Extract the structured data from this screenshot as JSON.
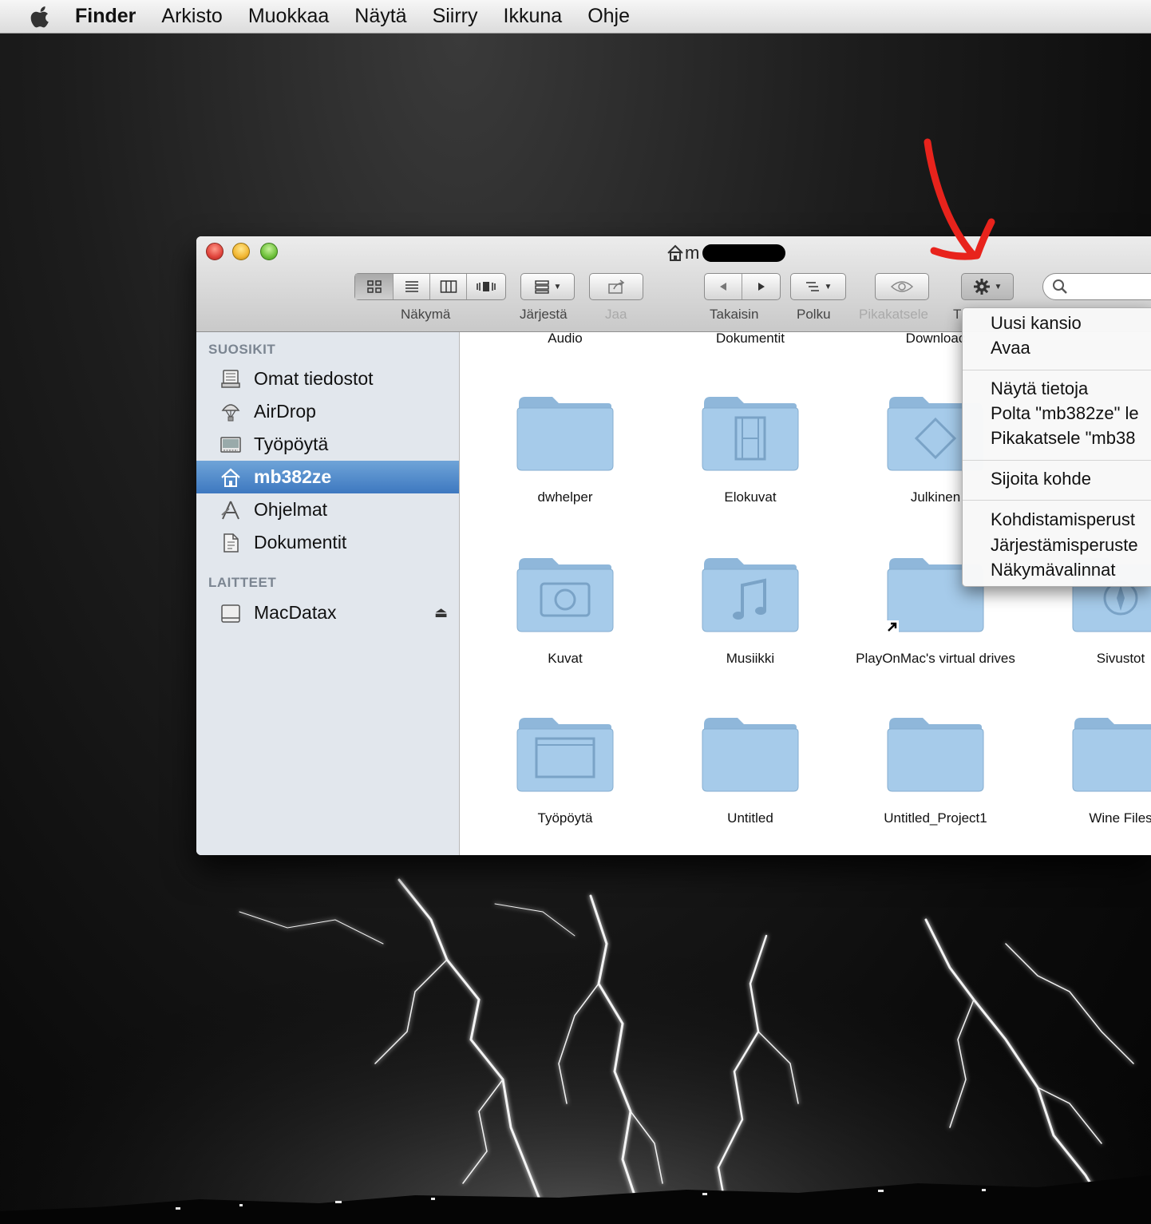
{
  "menubar": {
    "app": "Finder",
    "items": [
      "Arkisto",
      "Muokkaa",
      "Näytä",
      "Siirry",
      "Ikkuna",
      "Ohje"
    ]
  },
  "window": {
    "title_visible": "m",
    "toolbar": {
      "view_label": "Näkymä",
      "arrange_label": "Järjestä",
      "share_label": "Jaa",
      "back_label": "Takaisin",
      "path_label": "Polku",
      "quicklook_label": "Pikakatsele",
      "action_label_partial": "T"
    },
    "sidebar": {
      "favorites_header": "SUOSIKIT",
      "favorites": [
        {
          "label": "Omat tiedostot",
          "icon": "all-files-icon"
        },
        {
          "label": "AirDrop",
          "icon": "airdrop-icon"
        },
        {
          "label": "Työpöytä",
          "icon": "desktop-icon"
        },
        {
          "label": "mb382ze",
          "icon": "home-icon",
          "selected": true
        },
        {
          "label": "Ohjelmat",
          "icon": "applications-icon"
        },
        {
          "label": "Dokumentit",
          "icon": "documents-icon"
        }
      ],
      "devices_header": "LAITTEET",
      "devices": [
        {
          "label": "MacDatax",
          "icon": "disk-icon",
          "eject": "⏏"
        }
      ]
    },
    "content": {
      "top_row_cut_labels": [
        "Audio",
        "Dokumentit",
        "Downloac"
      ],
      "items": [
        {
          "name": "dwhelper",
          "glyph": "none"
        },
        {
          "name": "Elokuvat",
          "glyph": "film"
        },
        {
          "name": "Julkinen",
          "glyph": "public"
        },
        {
          "name": "Kuvat",
          "glyph": "camera"
        },
        {
          "name": "Musiikki",
          "glyph": "music"
        },
        {
          "name": "PlayOnMac's virtual drives",
          "glyph": "alias"
        },
        {
          "name": "Sivustot",
          "glyph": "compass"
        },
        {
          "name": "Työpöytä",
          "glyph": "desktop"
        },
        {
          "name": "Untitled",
          "glyph": "none"
        },
        {
          "name": "Untitled_Project1",
          "glyph": "none"
        },
        {
          "name": "Wine Files",
          "glyph": "none"
        }
      ]
    }
  },
  "action_menu": {
    "items": [
      "Uusi kansio",
      "Avaa",
      "Näytä tietoja",
      "Polta \"mb382ze\" le",
      "Pikakatsele \"mb38",
      "Sijoita kohde",
      "Kohdistamisperust",
      "Järjestämisperuste",
      "Näkymävalinnat"
    ]
  },
  "colors": {
    "annotation_arrow": "#e8231c",
    "sidebar_selection": "#3d78c0",
    "folder_blue": "#9cc4e6"
  }
}
